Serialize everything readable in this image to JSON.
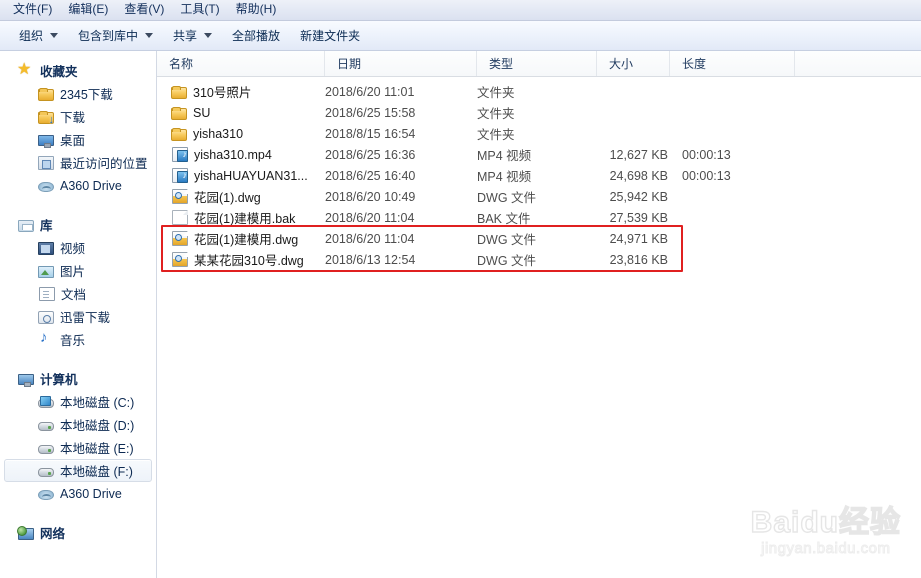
{
  "menubar": {
    "items": [
      {
        "label": "文件(F)",
        "name": "menu-file"
      },
      {
        "label": "编辑(E)",
        "name": "menu-edit"
      },
      {
        "label": "查看(V)",
        "name": "menu-view"
      },
      {
        "label": "工具(T)",
        "name": "menu-tools"
      },
      {
        "label": "帮助(H)",
        "name": "menu-help"
      }
    ]
  },
  "commandbar": {
    "items": [
      {
        "label": "组织",
        "caret": true,
        "name": "organize-button"
      },
      {
        "label": "包含到库中",
        "caret": true,
        "name": "include-in-library-button"
      },
      {
        "label": "共享",
        "caret": true,
        "name": "share-with-button"
      },
      {
        "label": "全部播放",
        "caret": false,
        "name": "play-all-button"
      },
      {
        "label": "新建文件夹",
        "caret": false,
        "name": "new-folder-button"
      }
    ]
  },
  "sidebar": {
    "groups": [
      {
        "name": "favorites",
        "header": {
          "label": "收藏夹",
          "icon": "star-icon"
        },
        "items": [
          {
            "label": "2345下载",
            "icon": "folder-icon",
            "selected": false
          },
          {
            "label": "下载",
            "icon": "folder-download-icon",
            "selected": false
          },
          {
            "label": "桌面",
            "icon": "desktop-icon",
            "selected": false
          },
          {
            "label": "最近访问的位置",
            "icon": "recent-places-icon",
            "selected": false
          },
          {
            "label": "A360 Drive",
            "icon": "cloud-icon",
            "selected": false
          }
        ]
      },
      {
        "name": "libraries",
        "header": {
          "label": "库",
          "icon": "library-icon"
        },
        "items": [
          {
            "label": "视频",
            "icon": "video-icon",
            "selected": false
          },
          {
            "label": "图片",
            "icon": "picture-icon",
            "selected": false
          },
          {
            "label": "文档",
            "icon": "document-icon",
            "selected": false
          },
          {
            "label": "迅雷下载",
            "icon": "thunder-download-icon",
            "selected": false
          },
          {
            "label": "音乐",
            "icon": "music-icon",
            "selected": false
          }
        ]
      },
      {
        "name": "computer",
        "header": {
          "label": "计算机",
          "icon": "computer-icon"
        },
        "items": [
          {
            "label": "本地磁盘 (C:)",
            "icon": "hdd-system-icon",
            "selected": false
          },
          {
            "label": "本地磁盘 (D:)",
            "icon": "hdd-icon",
            "selected": false
          },
          {
            "label": "本地磁盘 (E:)",
            "icon": "hdd-icon",
            "selected": false
          },
          {
            "label": "本地磁盘 (F:)",
            "icon": "hdd-icon",
            "selected": true
          },
          {
            "label": "A360 Drive",
            "icon": "cloud-icon",
            "selected": false
          }
        ]
      },
      {
        "name": "network",
        "header": {
          "label": "网络",
          "icon": "network-icon"
        },
        "items": []
      }
    ]
  },
  "filelist": {
    "columns": [
      {
        "label": "名称",
        "name": "column-name",
        "sorted": true
      },
      {
        "label": "日期",
        "name": "column-date",
        "sorted": false
      },
      {
        "label": "类型",
        "name": "column-type",
        "sorted": false
      },
      {
        "label": "大小",
        "name": "column-size",
        "sorted": false
      },
      {
        "label": "长度",
        "name": "column-length",
        "sorted": false
      }
    ],
    "rows": [
      {
        "icon": "folder-icon",
        "name": "310号照片",
        "date": "2018/6/20 11:01",
        "type": "文件夹",
        "size": "",
        "length": "",
        "highlighted": false
      },
      {
        "icon": "folder-icon",
        "name": "SU",
        "date": "2018/6/25 15:58",
        "type": "文件夹",
        "size": "",
        "length": "",
        "highlighted": false
      },
      {
        "icon": "folder-icon",
        "name": "yisha310",
        "date": "2018/8/15 16:54",
        "type": "文件夹",
        "size": "",
        "length": "",
        "highlighted": false
      },
      {
        "icon": "mp4-icon",
        "name": "yisha310.mp4",
        "date": "2018/6/25 16:36",
        "type": "MP4 视频",
        "size": "12,627 KB",
        "length": "00:00:13",
        "highlighted": false
      },
      {
        "icon": "mp4-icon",
        "name": "yishaHUAYUAN31...",
        "date": "2018/6/25 16:40",
        "type": "MP4 视频",
        "size": "24,698 KB",
        "length": "00:00:13",
        "highlighted": false
      },
      {
        "icon": "dwg-icon",
        "name": "花园(1).dwg",
        "date": "2018/6/20 10:49",
        "type": "DWG 文件",
        "size": "25,942 KB",
        "length": "",
        "highlighted": false
      },
      {
        "icon": "bak-icon",
        "name": "花园(1)建模用.bak",
        "date": "2018/6/20 11:04",
        "type": "BAK 文件",
        "size": "27,539 KB",
        "length": "",
        "highlighted": false
      },
      {
        "icon": "dwg-icon",
        "name": "花园(1)建模用.dwg",
        "date": "2018/6/20 11:04",
        "type": "DWG 文件",
        "size": "24,971 KB",
        "length": "",
        "highlighted": true
      },
      {
        "icon": "dwg-icon",
        "name": "某某花园310号.dwg",
        "date": "2018/6/13 12:54",
        "type": "DWG 文件",
        "size": "23,816 KB",
        "length": "",
        "highlighted": true
      }
    ]
  },
  "annotation": {
    "color": "#e02020",
    "name": "red-highlight-box"
  },
  "watermark": {
    "main": "Baidu经验",
    "sub": "jingyan.baidu.com"
  }
}
